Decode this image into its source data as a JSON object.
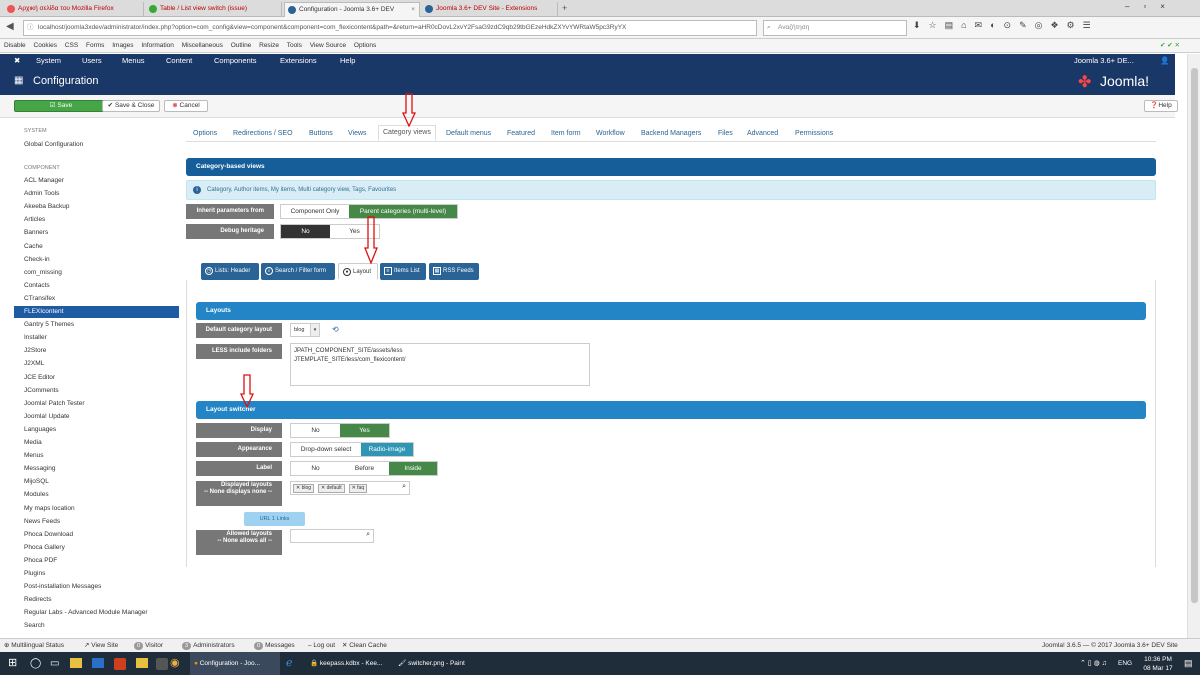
{
  "browser": {
    "tabs": [
      {
        "label": "Αρχική σελίδα του Mozilla Firefox",
        "x": 0
      },
      {
        "label": "Table / List view switch (issue)",
        "x": 0
      },
      {
        "label": "Configuration - Joomla 3.6+ DEV",
        "x": 0
      },
      {
        "label": "Joomla 3.6+ DEV Site - Extensions",
        "x": 0
      }
    ],
    "url": "localhost/joomla3xdev/administrator/index.php?option=com_config&view=component&component=com_flexicontent&path=&return=aHR0cDovL2xvY2FsaG9zdC9qb29tbGEzeHdkZXYvYWRtaW5pc3RyYX",
    "search_placeholder": "Αναζήτηση",
    "bookmarks": [
      "Disable",
      "Cookies",
      "CSS",
      "Forms",
      "Images",
      "Information",
      "Miscellaneous",
      "Outline",
      "Resize",
      "Tools",
      "View Source",
      "Options"
    ]
  },
  "jnav": {
    "items": [
      "System",
      "Users",
      "Menus",
      "Content",
      "Components",
      "Extensions",
      "Help"
    ],
    "site_name": "Joomla 3.6+ DE...",
    "user_icon": "user-icon"
  },
  "header": {
    "title": "Configuration",
    "logo_text": "Joomla!"
  },
  "toolbar": {
    "save": "Save",
    "save_close": "Save & Close",
    "cancel": "Cancel",
    "help": "Help"
  },
  "sidebar": {
    "system_head": "SYSTEM",
    "global_config": "Global Configuration",
    "component_head": "COMPONENT",
    "items": [
      "ACL Manager",
      "Admin Tools",
      "Akeeba Backup",
      "Articles",
      "Banners",
      "Cache",
      "Check-in",
      "com_missing",
      "Contacts",
      "CTransifex",
      "FLEXIcontent",
      "Gantry 5 Themes",
      "Installer",
      "J2Store",
      "J2XML",
      "JCE Editor",
      "JComments",
      "Joomla! Patch Tester",
      "Joomla! Update",
      "Languages",
      "Media",
      "Menus",
      "Messaging",
      "MijoSQL",
      "Modules",
      "My maps location",
      "News Feeds",
      "Phoca Download",
      "Phoca Gallery",
      "Phoca PDF",
      "Plugins",
      "Post-installation Messages",
      "Redirects",
      "Regular Labs - Advanced Module Manager",
      "Search"
    ],
    "active": "FLEXIcontent"
  },
  "config_tabs": [
    "Options",
    "Redirections / SEO",
    "Buttons",
    "Views",
    "Category views",
    "Default menus",
    "Featured",
    "Item form",
    "Workflow",
    "Backend Managers",
    "Files",
    "Advanced",
    "Permissions"
  ],
  "config_tab_active": "Category views",
  "section": {
    "title": "Category-based views",
    "info": "Category, Author items, My items, Multi category view, Tags, Favourites",
    "inherit_label": "Inherit parameters from",
    "inherit_options": [
      "Component Only",
      "Parent categories (multi-level)"
    ],
    "debug_label": "Debug heritage",
    "debug_options": [
      "No",
      "Yes"
    ]
  },
  "sub_tabs": [
    "Lists: Header",
    "Search / Filter form",
    "Layout",
    "Items List",
    "RSS Feeds"
  ],
  "sub_tab_active": "Layout",
  "layouts": {
    "title": "Layouts",
    "default_label": "Default category layout",
    "default_value": "blog",
    "less_label": "LESS include folders",
    "less_value_1": "JPATH_COMPONENT_SITE/assets/less",
    "less_value_2": "JTEMPLATE_SITE/less/com_flexicontent/"
  },
  "switcher": {
    "title": "Layout switcher",
    "display_label": "Display",
    "display_options": [
      "No",
      "Yes"
    ],
    "appearance_label": "Appearance",
    "appearance_options": [
      "Drop-down select",
      "Radio-image"
    ],
    "label_label": "Label",
    "label_options": [
      "No",
      "Before",
      "Inside"
    ],
    "displayed_label_1": "Displayed layouts",
    "displayed_label_2": "-- None displays none --",
    "chips": [
      "blog",
      "default",
      "faq"
    ],
    "url_button": "URL 1 Links",
    "allowed_label_1": "Allowed layouts",
    "allowed_label_2": "-- None allows all --"
  },
  "statusbar": {
    "multilingual": "Multilingual Status",
    "view_site": "View Site",
    "visitor_count": "0",
    "visitor": "Visitor",
    "admin_count": "3",
    "admins": "Administrators",
    "msg_count": "0",
    "messages": "Messages",
    "logout": "Log out",
    "clean_cache": "Clean Cache",
    "footer": "Joomla! 3.6.5 — © 2017 Joomla 3.6+ DEV Site"
  },
  "taskbar": {
    "firefox": "Configuration - Joo...",
    "keepass": "keepass.kdbx - Kee...",
    "paint": "switcher.png - Paint",
    "lang": "ENG",
    "time": "10:36 PM",
    "date": "08 Mar 17"
  }
}
